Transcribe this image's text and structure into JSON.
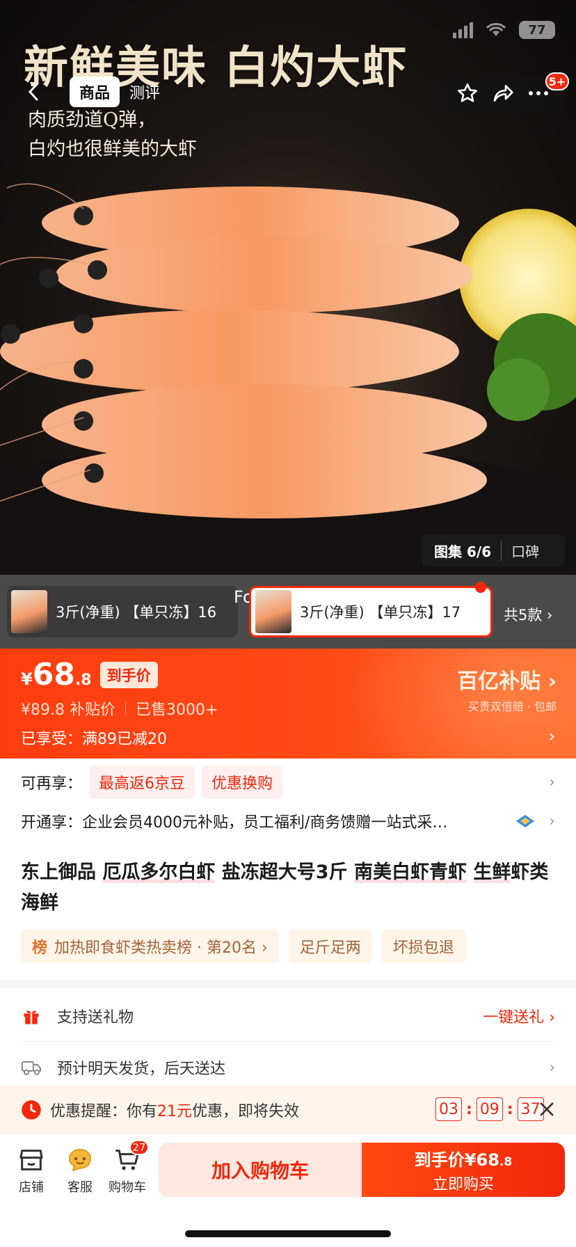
{
  "status": {
    "battery": "77"
  },
  "hero": {
    "title": "新鲜美味 白灼大虾",
    "subtitle_line1": "肉质劲道Q弹，",
    "subtitle_line2": "白灼也很鲜美的大虾"
  },
  "nav": {
    "tabs": [
      {
        "label": "商品"
      },
      {
        "label": "测评"
      }
    ],
    "more_badge": "5+"
  },
  "gallery": {
    "label": "图集",
    "index": "6/6",
    "reviews_label": "口碑"
  },
  "variants": {
    "items": [
      {
        "label": "3斤(净重) 【单只冻】16"
      },
      {
        "label": "3斤(净重) 【单只冻】17"
      }
    ],
    "overlay_text": "Forcast",
    "more_label": "共5款 ›"
  },
  "price": {
    "yen": "¥",
    "integer": "68",
    "decimal": ".8",
    "tag": "到手价",
    "original": "¥89.8",
    "original_label": "补贴价",
    "sold": "已售3000+",
    "promo": "已享受：满89已减20",
    "subsidy_logo": "百亿补贴 ›",
    "subsidy_desc": "买贵双倍赔 · 包邮"
  },
  "benefits": {
    "label": "可再享：",
    "chips": [
      "最高返6京豆",
      "优惠换购"
    ]
  },
  "membership": {
    "text": "开通享：企业会员4000元补贴，员工福利/商务馈赠一站式采…"
  },
  "product": {
    "title_parts": [
      {
        "text": "东上御品 ",
        "hl": false
      },
      {
        "text": "厄瓜多尔白虾",
        "hl": true
      },
      {
        "text": " 盐冻超大号3斤 ",
        "hl": false
      },
      {
        "text": "南美白虾青虾",
        "hl": true
      },
      {
        "text": " ",
        "hl": false
      },
      {
        "text": "生鲜",
        "hl": true
      },
      {
        "text": "虾类 海鲜",
        "hl": false
      }
    ]
  },
  "tags": {
    "rank_icon": "榜",
    "rank_text": "加热即食虾类热卖榜 · 第20名 ›",
    "t2": "足斤足两",
    "t3": "坏损包退"
  },
  "services": {
    "gift_label": "支持送礼物",
    "gift_action": "一键送礼 ›",
    "delivery_label": "预计明天发货，后天送达"
  },
  "reminder": {
    "prefix": "优惠提醒：你有",
    "amount": "21元",
    "suffix": "优惠，即将失效",
    "hh": "03",
    "mm": "09",
    "ss": "37"
  },
  "bottom": {
    "shop": "店铺",
    "service": "客服",
    "cart": "购物车",
    "cart_count": "27",
    "add_cart": "加入购物车",
    "buy_price_label": "到手价¥68",
    "buy_price_dec": ".8",
    "buy_now": "立即购买"
  },
  "colors": {
    "accent": "#f2270c",
    "banner": "#ff4a16"
  }
}
